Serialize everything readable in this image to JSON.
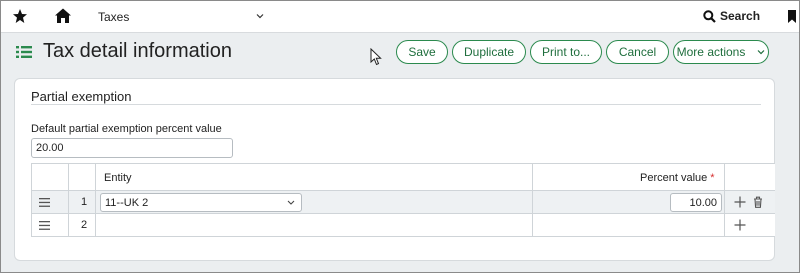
{
  "topbar": {
    "module": "Taxes",
    "search_label": "Search"
  },
  "page": {
    "title": "Tax detail information"
  },
  "actions": {
    "save": "Save",
    "duplicate": "Duplicate",
    "print": "Print to...",
    "cancel": "Cancel",
    "more": "More actions"
  },
  "section": {
    "title": "Partial exemption",
    "default_label": "Default partial exemption percent value",
    "default_value": "20.00"
  },
  "grid": {
    "headers": {
      "entity": "Entity",
      "percent": "Percent value",
      "required_mark": "*"
    },
    "rows": [
      {
        "num": "1",
        "entity": "11--UK 2",
        "percent": "10.00"
      },
      {
        "num": "2",
        "entity": "",
        "percent": ""
      }
    ]
  },
  "colors": {
    "accent": "#2b8a4e",
    "required": "#d62e2e"
  }
}
